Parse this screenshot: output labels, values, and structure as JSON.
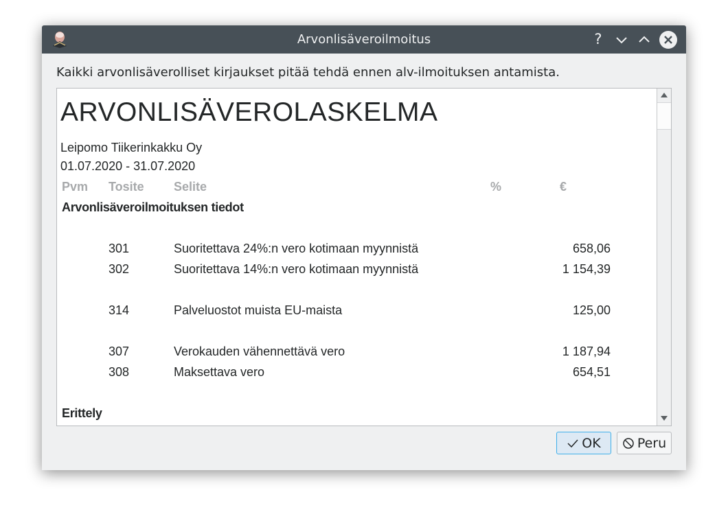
{
  "window": {
    "title": "Arvonlisäveroilmoitus",
    "help_label": "?"
  },
  "intro_text": "Kaikki arvonlisäverolliset kirjaukset pitää tehdä ennen alv-ilmoituksen antamista.",
  "report": {
    "title": "ARVONLISÄVEROLASKELMA",
    "company": "Leipomo Tiikerinkakku Oy",
    "period": "01.07.2020 - 31.07.2020",
    "columns": [
      "Pvm",
      "Tosite",
      "Selite",
      "%",
      "€"
    ],
    "section_title": "Arvonlisäveroilmoituksen tiedot",
    "rows": [
      {
        "code": "301",
        "description": "Suoritettava 24%:n vero kotimaan myynnistä",
        "amount": "658,06"
      },
      {
        "code": "302",
        "description": "Suoritettava 14%:n vero kotimaan myynnistä",
        "amount": "1 154,39"
      },
      {
        "code": "314",
        "description": "Palveluostot muista EU-maista",
        "amount": "125,00"
      },
      {
        "code": "307",
        "description": "Verokauden vähennettävä vero",
        "amount": "1 187,94"
      },
      {
        "code": "308",
        "description": "Maksettava vero",
        "amount": "654,51"
      }
    ],
    "section2_title": "Erittely"
  },
  "buttons": {
    "ok": "OK",
    "cancel": "Peru"
  },
  "icons": {
    "app": "app-icon",
    "help": "help-icon",
    "minimize": "chevron-down-icon",
    "maximize": "chevron-up-icon",
    "close": "close-icon",
    "ok": "checkmark-icon",
    "cancel": "cancel-icon"
  },
  "colors": {
    "titlebar": "#475057",
    "accent": "#3daee9",
    "background": "#eff0f1"
  }
}
